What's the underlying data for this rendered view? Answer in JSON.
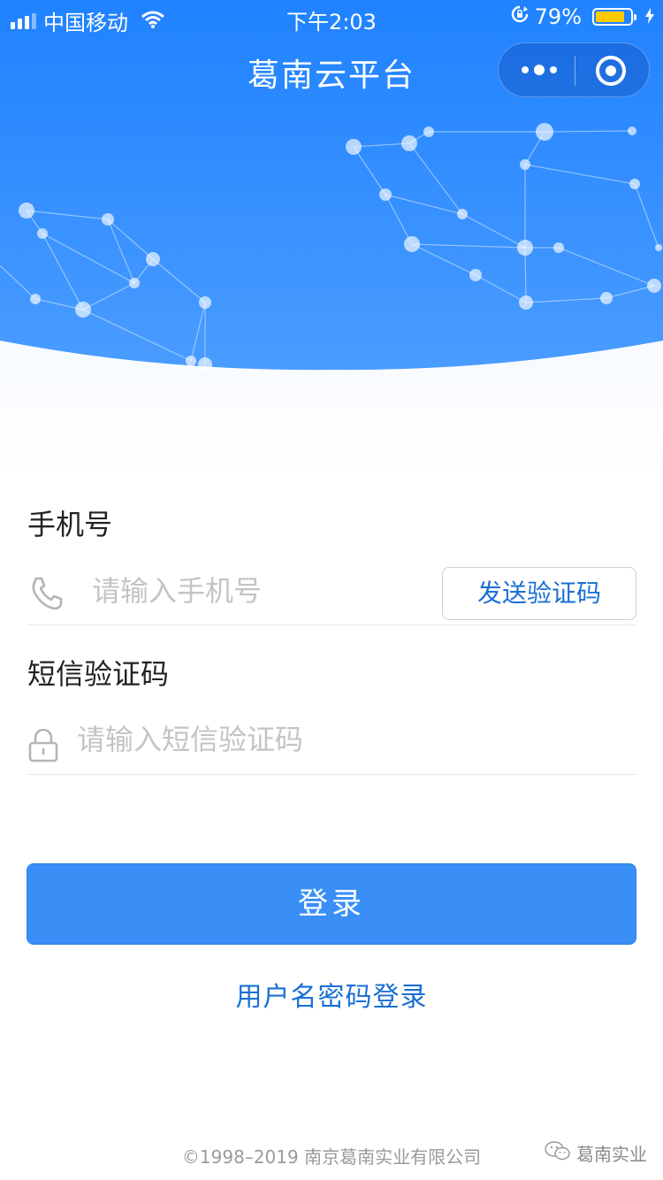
{
  "status_bar": {
    "carrier": "中国移动",
    "time": "下午2:03",
    "battery_percent": "79%",
    "battery_level": 0.79,
    "battery_color": "#ffcc00"
  },
  "nav": {
    "title": "葛南云平台"
  },
  "form": {
    "phone_label": "手机号",
    "phone_placeholder": "请输入手机号",
    "phone_value": "",
    "send_code_label": "发送验证码",
    "code_label": "短信验证码",
    "code_placeholder": "请输入短信验证码",
    "code_value": ""
  },
  "actions": {
    "login_label": "登录",
    "alt_login_label": "用户名密码登录"
  },
  "footer": {
    "copyright": "©1998–2019 南京葛南实业有限公司",
    "watermark": "葛南实业"
  },
  "colors": {
    "primary": "#3a8ff7",
    "link": "#1a6fd4",
    "header_gradient_top": "#1f82ff",
    "header_gradient_bottom": "#4a9cff"
  },
  "icons": {
    "phone": "phone-icon",
    "lock": "lock-icon",
    "more": "more-dots-icon",
    "close": "close-miniprogram-icon"
  }
}
